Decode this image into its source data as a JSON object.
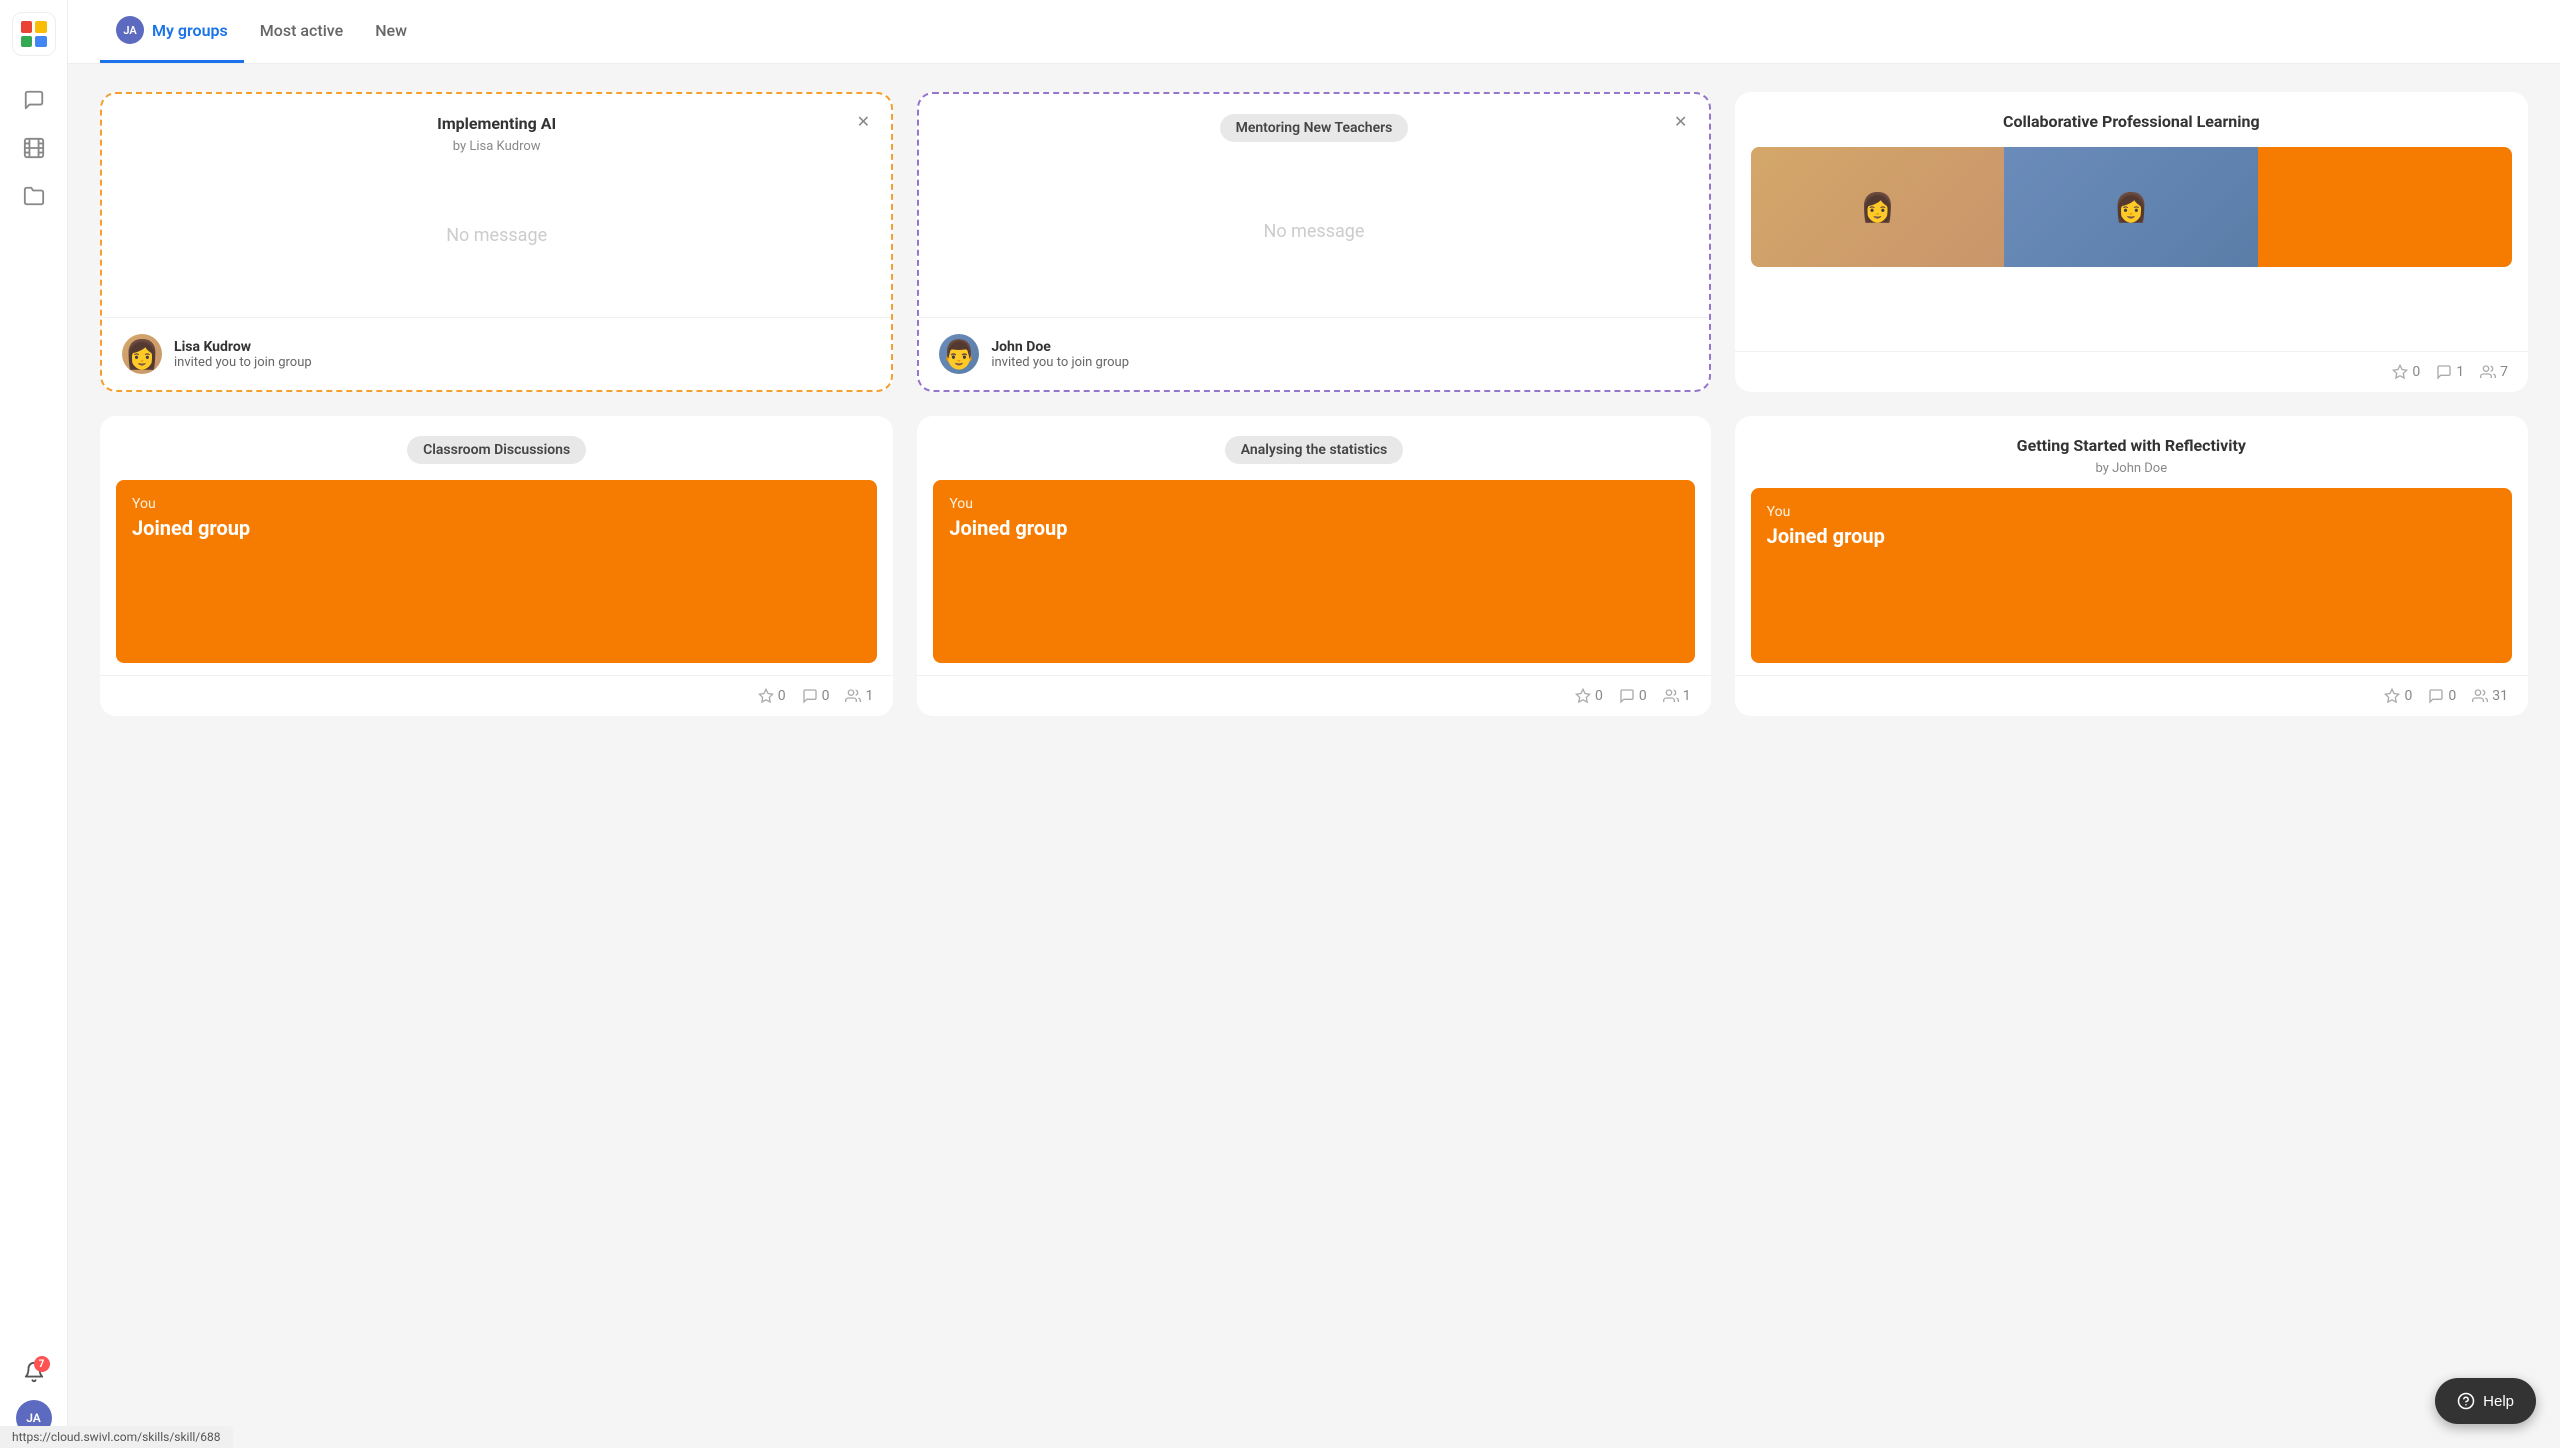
{
  "sidebar": {
    "logo_initials": "JA",
    "icons": [
      {
        "name": "chat-icon",
        "symbol": "💬"
      },
      {
        "name": "film-icon",
        "symbol": "🎞"
      },
      {
        "name": "folder-icon",
        "symbol": "📁"
      }
    ],
    "notification_count": "7",
    "user_initials": "JA"
  },
  "tabs": {
    "items": [
      {
        "label": "My groups",
        "active": true,
        "avatar": "JA"
      },
      {
        "label": "Most active",
        "active": false
      },
      {
        "label": "New",
        "active": false
      }
    ]
  },
  "cards": [
    {
      "id": "implementing-ai",
      "type": "invite",
      "border_color": "orange",
      "title": "Implementing AI",
      "subtitle": "by Lisa Kudrow",
      "no_message": "No message",
      "inviter_name": "Lisa Kudrow",
      "invite_text": "invited you to join group",
      "has_close": true
    },
    {
      "id": "mentoring-new-teachers",
      "type": "invite",
      "border_color": "purple",
      "title": "Mentoring New Teachers",
      "subtitle": null,
      "no_message": "No message",
      "inviter_name": "John Doe",
      "invite_text": "invited you to join group",
      "has_close": true
    },
    {
      "id": "collaborative-professional-learning",
      "type": "activity",
      "title": "Collaborative Professional Learning",
      "subtitle": null,
      "stats": {
        "stars": "0",
        "comments": "1",
        "members": "7"
      }
    },
    {
      "id": "classroom-discussions",
      "type": "joined",
      "title": "Classroom Discussions",
      "you_label": "You",
      "joined_label": "Joined group",
      "stats": {
        "stars": "0",
        "comments": "0",
        "members": "1"
      }
    },
    {
      "id": "analysing-the-statistics",
      "type": "joined",
      "title": "Analysing the statistics",
      "you_label": "You",
      "joined_label": "Joined group",
      "stats": {
        "stars": "0",
        "comments": "0",
        "members": "1"
      }
    },
    {
      "id": "getting-started-with-reflectivity",
      "type": "joined",
      "title": "Getting Started with Reflectivity",
      "subtitle": "by John Doe",
      "you_label": "You",
      "joined_label": "Joined group",
      "stats": {
        "stars": "0",
        "comments": "0",
        "members": "31"
      }
    }
  ],
  "url_bar": "https://cloud.swivl.com/skills/skill/688",
  "help_button": "Help"
}
